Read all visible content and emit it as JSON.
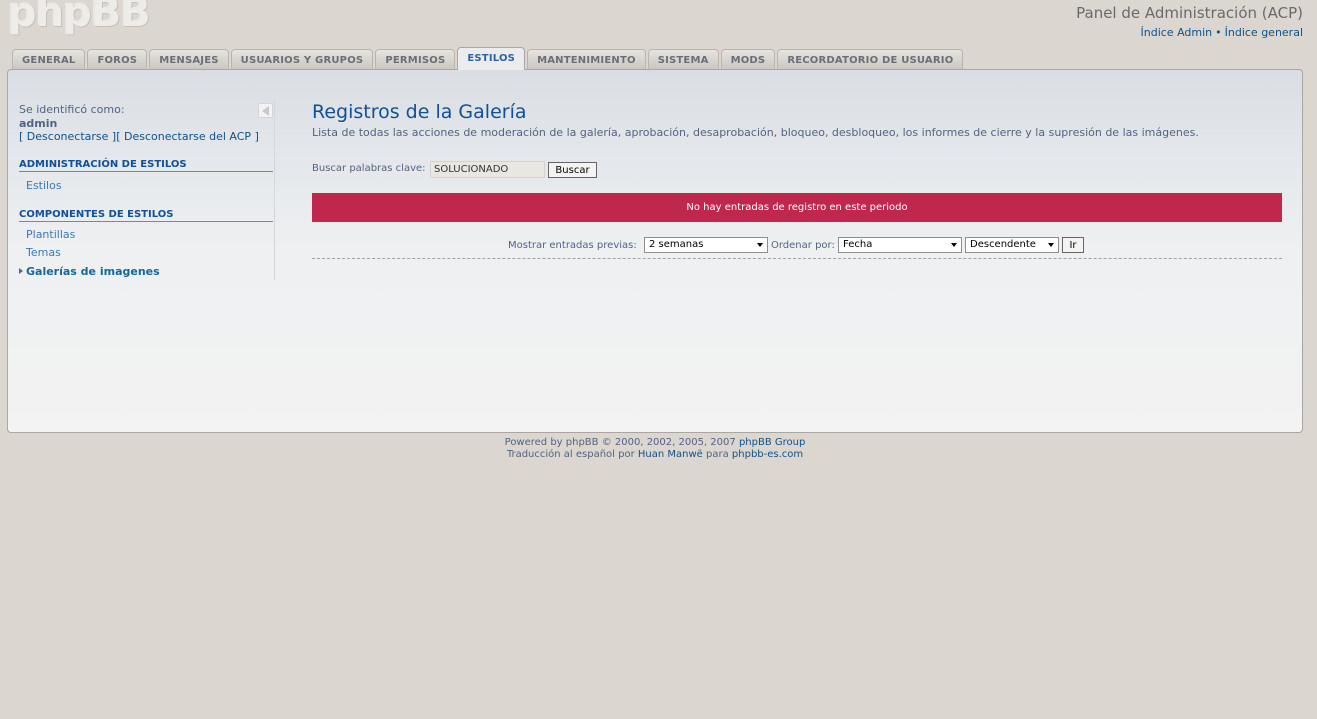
{
  "header": {
    "logo_text": "phpBB",
    "acp_title": "Panel de Administración (ACP)",
    "links": [
      "Índice Admin",
      "Índice general"
    ],
    "link_separator": "•"
  },
  "tabs": [
    {
      "label": "GENERAL",
      "active": false
    },
    {
      "label": "FOROS",
      "active": false
    },
    {
      "label": "MENSAJES",
      "active": false
    },
    {
      "label": "USUARIOS Y GRUPOS",
      "active": false
    },
    {
      "label": "PERMISOS",
      "active": false
    },
    {
      "label": "ESTILOS",
      "active": true
    },
    {
      "label": "MANTENIMIENTO",
      "active": false
    },
    {
      "label": "SISTEMA",
      "active": false
    },
    {
      "label": "MODS",
      "active": false
    },
    {
      "label": "RECORDATORIO DE USUARIO",
      "active": false
    }
  ],
  "sidebar": {
    "identified_label": "Se identificó como:",
    "username": "admin",
    "logout_link": "Desconectarse",
    "logout_acp_link": "Desconectarse del ACP",
    "bracket_open": "[",
    "bracket_mid": "][",
    "bracket_close": "]",
    "sections": [
      {
        "title": "ADMINISTRACIÓN DE ESTILOS",
        "items": [
          {
            "label": "Estilos",
            "active": false
          }
        ]
      },
      {
        "title": "COMPONENTES DE ESTILOS",
        "items": [
          {
            "label": "Plantillas",
            "active": false
          },
          {
            "label": "Temas",
            "active": false
          },
          {
            "label": "Galerías de imagenes",
            "active": true
          }
        ]
      }
    ]
  },
  "main": {
    "title": "Registros de la Galería",
    "description": "Lista de todas las acciones de moderación de la galería, aprobación, desaprobación, bloqueo, desbloqueo, los informes de cierre y la supresión de las imágenes.",
    "search_label": "Buscar palabras clave:",
    "search_value": "SOLUCIONADO",
    "search_button": "Buscar",
    "error_message": "No hay entradas de registro en este periodo",
    "show_entries_label": "Mostrar entradas previas:",
    "show_entries_value": "2 semanas",
    "order_label": "Ordenar por:",
    "order_value": "Fecha",
    "direction_value": "Descendente",
    "go_button": "Ir"
  },
  "footer": {
    "powered_prefix": "Powered by phpBB © 2000, 2002, 2005, 2007",
    "powered_link": "phpBB Group",
    "translation_prefix": "Traducción al español por",
    "translator_link": "Huan Manwë",
    "translation_mid": "para",
    "site_link": "phpbb-es.com"
  },
  "colors": {
    "background": "#dbd6d0",
    "link": "#105289",
    "error_bar": "#bf284c",
    "active_tab_text": "#2d63a3"
  }
}
